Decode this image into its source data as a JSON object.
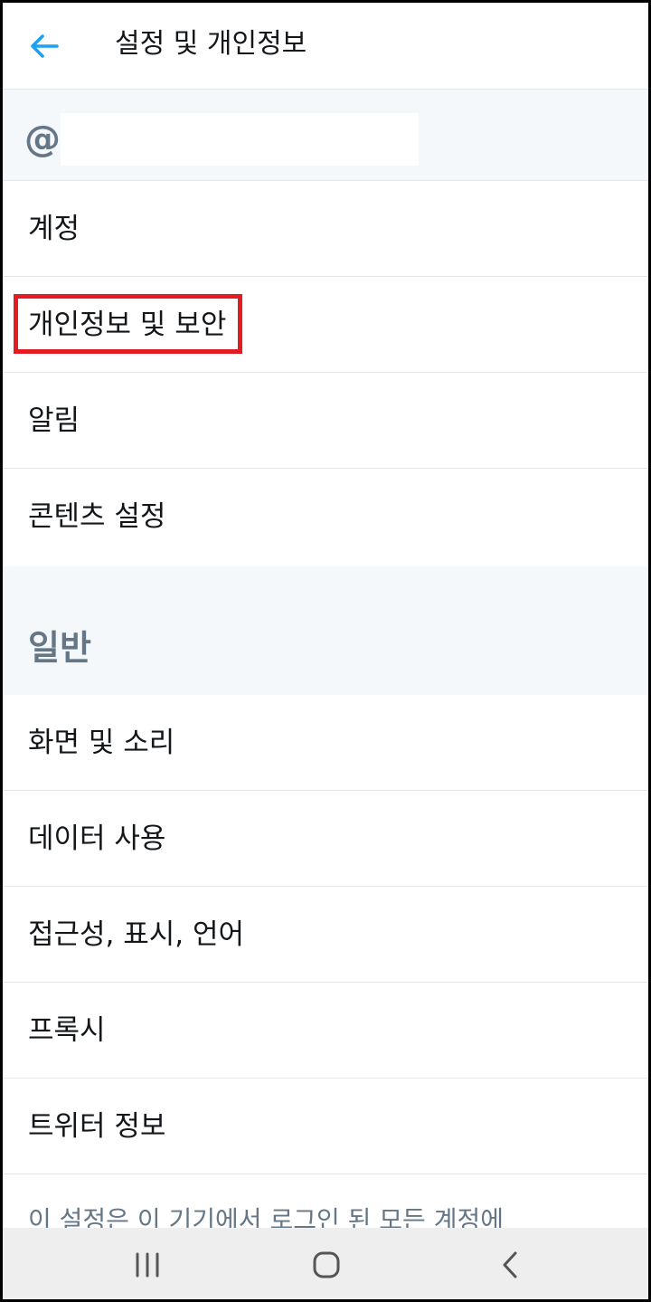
{
  "header": {
    "title": "설정 및 개인정보",
    "back_icon": "arrow-left-icon",
    "accent_color": "#1da1f2"
  },
  "account": {
    "handle_prefix": "@"
  },
  "menu": {
    "items": [
      {
        "label": "계정"
      },
      {
        "label": "개인정보 및 보안"
      },
      {
        "label": "알림"
      },
      {
        "label": "콘텐츠 설정"
      }
    ]
  },
  "general": {
    "title": "일반",
    "items": [
      {
        "label": "화면 및 소리"
      },
      {
        "label": "데이터 사용"
      },
      {
        "label": "접근성, 표시, 언어"
      },
      {
        "label": "프록시"
      },
      {
        "label": "트위터 정보"
      }
    ]
  },
  "footnote": "이 설정은 이 기기에서 로그인 된 모든 계정에",
  "navbar": {
    "recent_icon": "recent-apps-icon",
    "home_icon": "home-icon",
    "back_icon": "chevron-left-icon"
  },
  "highlight_color": "#e31b23"
}
